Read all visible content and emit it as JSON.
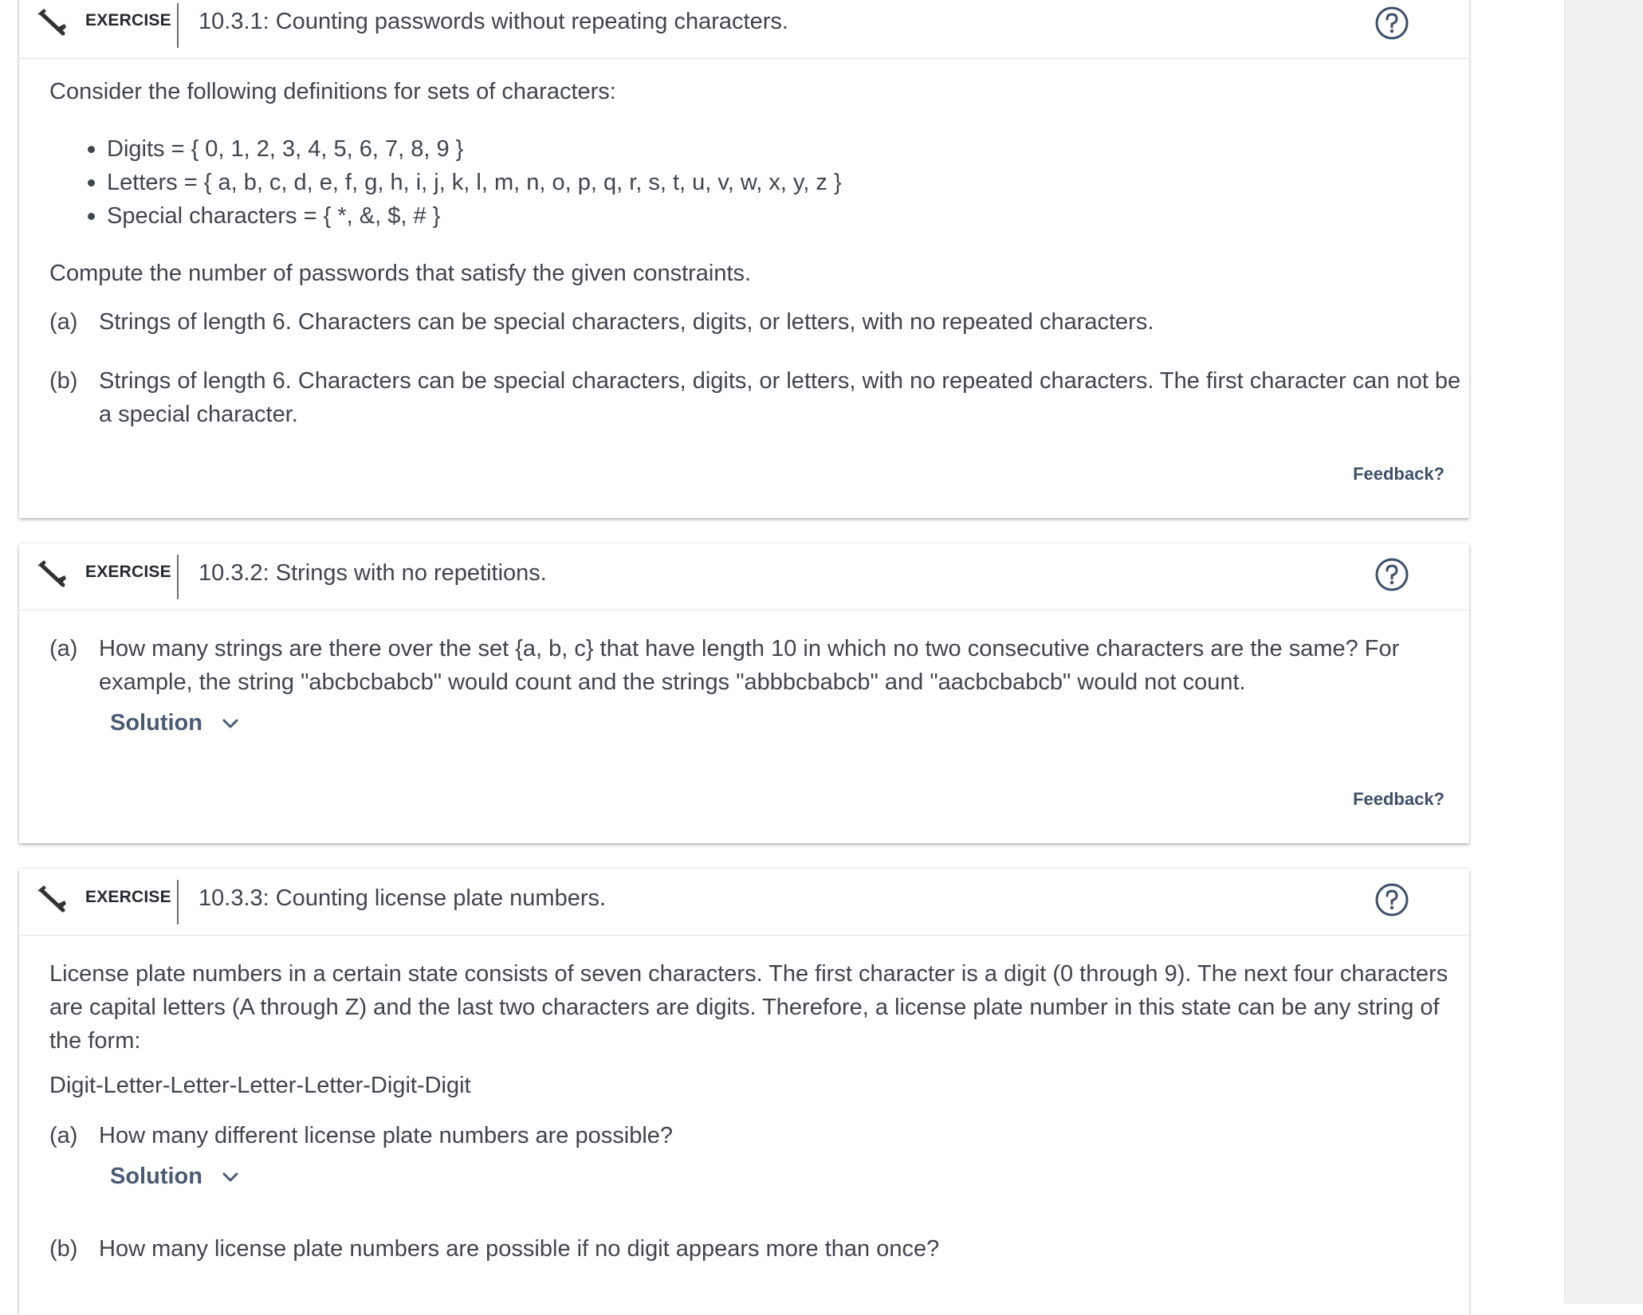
{
  "exercises": [
    {
      "label": "EXERCISE",
      "title": "10.3.1: Counting passwords without repeating characters.",
      "intro": "Consider the following definitions for sets of characters:",
      "sets": [
        "Digits = { 0, 1, 2, 3, 4, 5, 6, 7, 8, 9 }",
        "Letters = { a, b, c, d, e, f, g, h, i, j, k, l, m, n, o, p, q, r, s, t, u, v, w, x, y, z }",
        "Special characters = { *, &, $, # }"
      ],
      "prompt": "Compute the number of passwords that satisfy the given constraints.",
      "parts": [
        {
          "letter": "(a)",
          "text": "Strings of length 6. Characters can be special characters, digits, or letters, with no repeated characters."
        },
        {
          "letter": "(b)",
          "text": "Strings of length 6. Characters can be special characters, digits, or letters, with no repeated characters. The first character can not be a special character."
        }
      ],
      "feedback": "Feedback?"
    },
    {
      "label": "EXERCISE",
      "title": "10.3.2: Strings with no repetitions.",
      "parts": [
        {
          "letter": "(a)",
          "text": "How many strings are there over the set {a, b, c} that have length 10 in which no two consecutive characters are the same? For example, the string \"abcbcbabcb\" would count and the strings \"abbbcbabcb\" and \"aacbcbabcb\" would not count.",
          "solution": "Solution"
        }
      ],
      "feedback": "Feedback?"
    },
    {
      "label": "EXERCISE",
      "title": "10.3.3: Counting license plate numbers.",
      "intro": "License plate numbers in a certain state consists of seven characters. The first character is a digit (0 through 9). The next four characters are capital letters (A through Z) and the last two characters are digits. Therefore, a license plate number in this state can be any string of the form:",
      "form": "Digit-Letter-Letter-Letter-Letter-Digit-Digit",
      "parts": [
        {
          "letter": "(a)",
          "text": "How many different license plate numbers are possible?",
          "solution": "Solution"
        },
        {
          "letter": "(b)",
          "text": "How many license plate numbers are possible if no digit appears more than once?"
        }
      ]
    }
  ],
  "icons": {
    "exercise": "exercise-hammer-icon",
    "help": "help-circle-icon",
    "expand": "chevron-down-icon"
  }
}
